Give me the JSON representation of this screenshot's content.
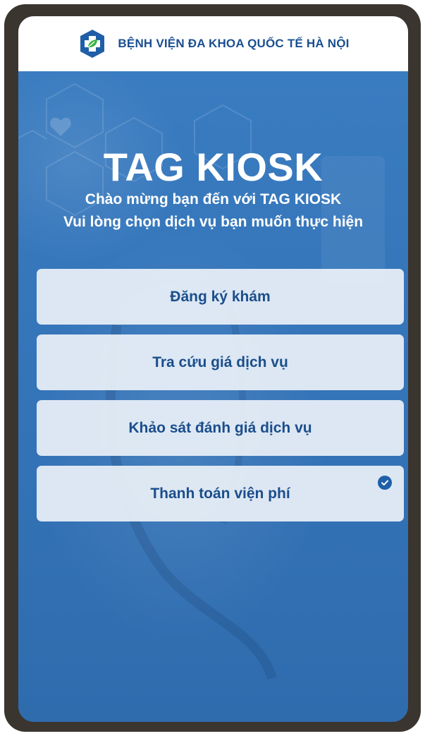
{
  "header": {
    "hospital_name": "BỆNH VIỆN ĐA KHOA QUỐC TẾ HÀ NỘI",
    "logo_icon": "medical-cross-leaf-icon"
  },
  "hero": {
    "title": "TAG KIOSK",
    "welcome": "Chào mừng bạn đến với TAG KIOSK",
    "instruction": "Vui lòng chọn dịch vụ bạn muốn thực hiện"
  },
  "menu": {
    "items": [
      {
        "label": "Đăng ký khám",
        "selected": false
      },
      {
        "label": "Tra cứu giá dịch vụ",
        "selected": false
      },
      {
        "label": "Khảo sát đánh giá dịch vụ",
        "selected": false
      },
      {
        "label": "Thanh toán viện phí",
        "selected": true
      }
    ]
  },
  "colors": {
    "primary": "#1b4e8c",
    "background": "#3575ba",
    "button_bg": "#e9f0f8",
    "frame": "#3b3530"
  }
}
